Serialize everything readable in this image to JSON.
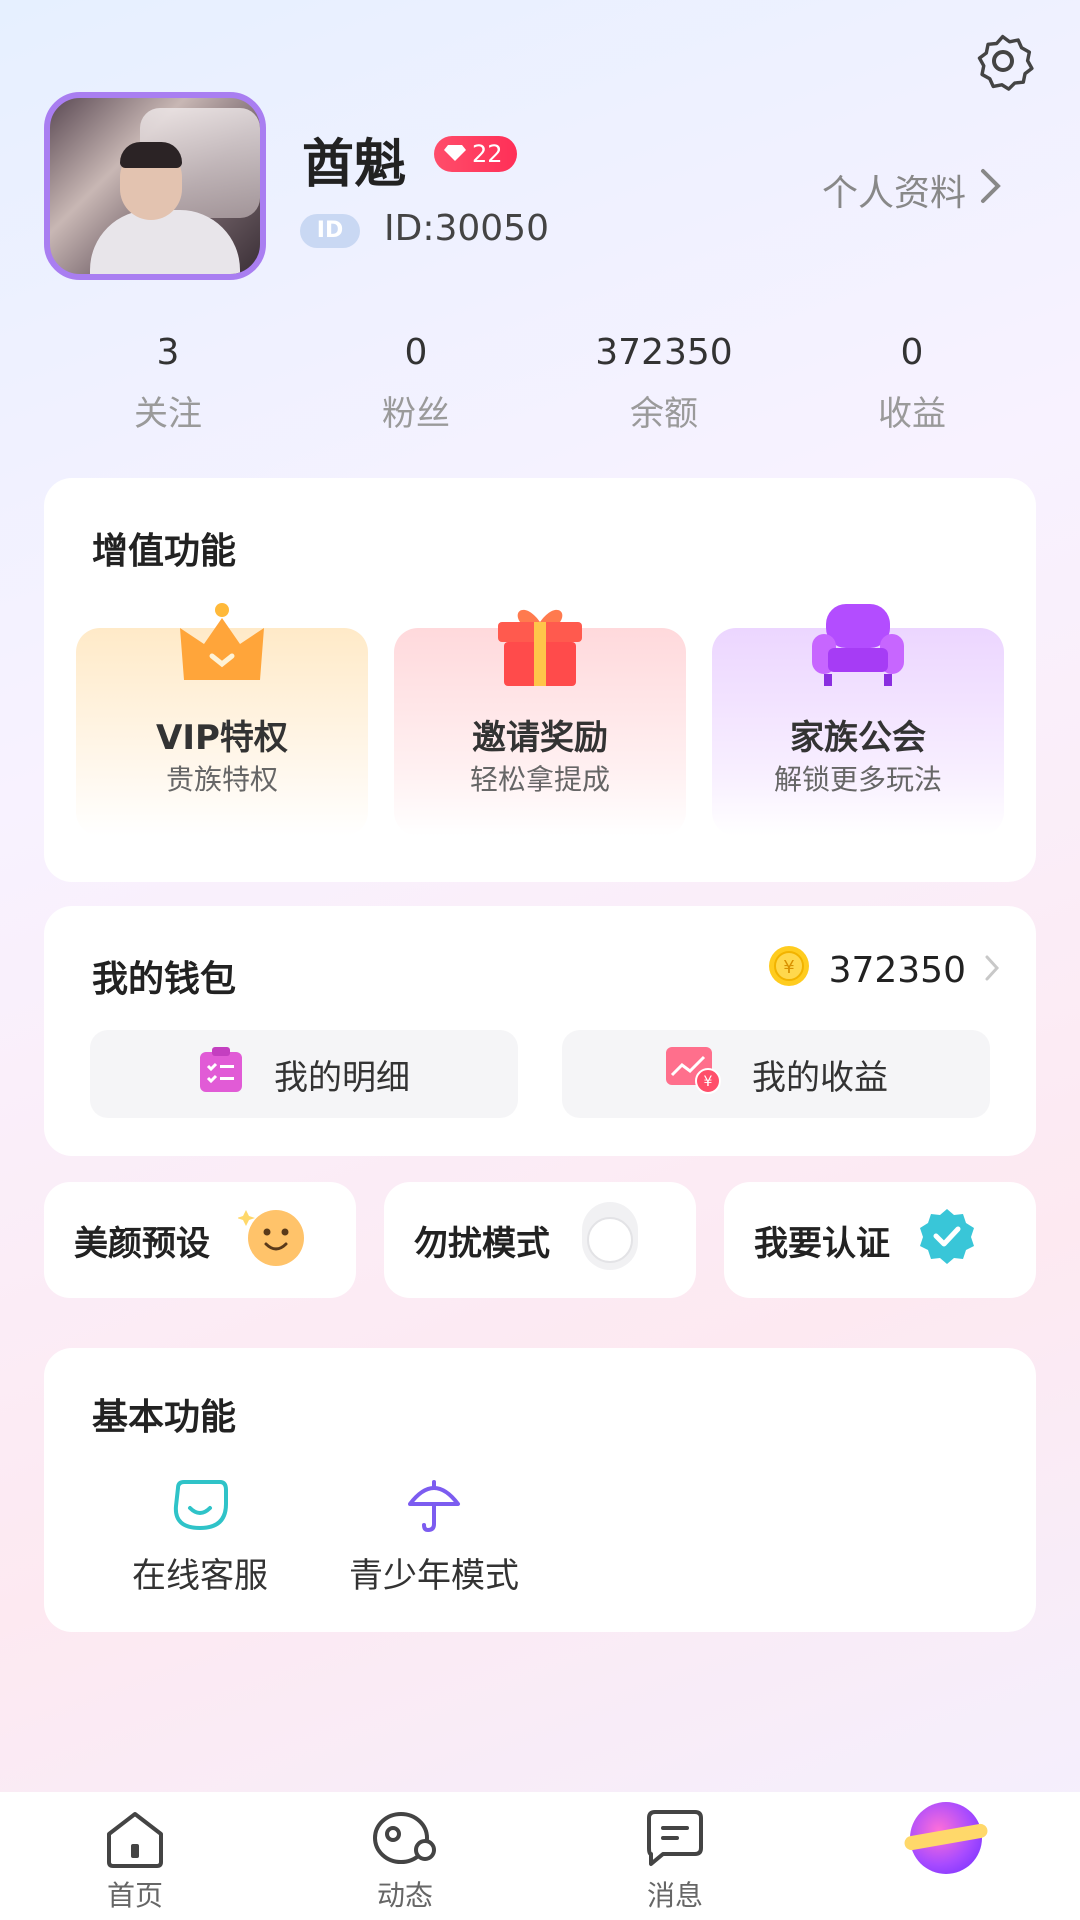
{
  "header": {
    "username": "酋魁",
    "level": "22",
    "id_tag": "ID",
    "id_text": "ID:30050",
    "profile_link": "个人资料"
  },
  "stats": [
    {
      "value": "3",
      "label": "关注"
    },
    {
      "value": "0",
      "label": "粉丝"
    },
    {
      "value": "372350",
      "label": "余额"
    },
    {
      "value": "0",
      "label": "收益"
    }
  ],
  "value_added": {
    "title": "增值功能",
    "items": [
      {
        "name": "VIP特权",
        "sub": "贵族特权",
        "icon": "crown-icon"
      },
      {
        "name": "邀请奖励",
        "sub": "轻松拿提成",
        "icon": "gift-icon"
      },
      {
        "name": "家族公会",
        "sub": "解锁更多玩法",
        "icon": "sofa-icon"
      }
    ]
  },
  "wallet": {
    "title": "我的钱包",
    "balance": "372350",
    "detail_label": "我的明细",
    "income_label": "我的收益"
  },
  "quick": {
    "beauty_label": "美颜预设",
    "dnd_label": "勿扰模式",
    "dnd_on": false,
    "verify_label": "我要认证"
  },
  "basic": {
    "title": "基本功能",
    "items": [
      {
        "label": "在线客服",
        "icon": "customer-service-icon"
      },
      {
        "label": "青少年模式",
        "icon": "umbrella-icon"
      }
    ]
  },
  "nav": {
    "home": "首页",
    "moments": "动态",
    "messages": "消息"
  },
  "colors": {
    "accent_purple": "#a97ef1",
    "badge_red": "#ff2f57",
    "verify_teal": "#39c6d8"
  }
}
